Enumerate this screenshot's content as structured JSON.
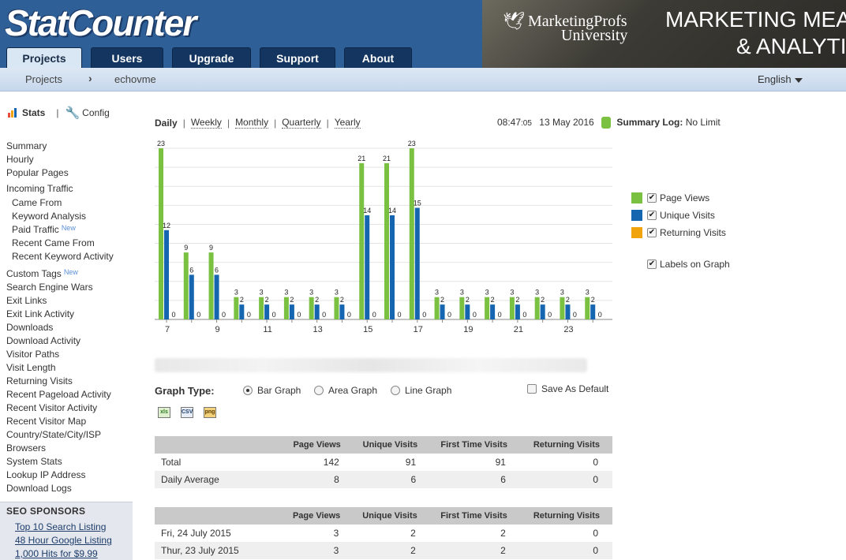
{
  "header": {
    "logo_text": "StatCounter",
    "banner_brand_line1": "MarketingProfs",
    "banner_brand_line2": "University",
    "banner_title_line1": "MARKETING MEASU",
    "banner_title_line2": "& ANALYTIC"
  },
  "tabs": [
    {
      "label": "Projects",
      "active": true
    },
    {
      "label": "Users",
      "active": false
    },
    {
      "label": "Upgrade",
      "active": false
    },
    {
      "label": "Support",
      "active": false
    },
    {
      "label": "About",
      "active": false
    }
  ],
  "breadcrumb": {
    "root": "Projects",
    "separator": "›",
    "project": "echovme"
  },
  "language": "English",
  "sidebar": {
    "stats_label": "Stats",
    "config_label": "Config",
    "pipe": "|",
    "items": [
      {
        "label": "Summary",
        "sub": false
      },
      {
        "label": "Hourly",
        "sub": false
      },
      {
        "label": "Popular Pages",
        "sub": false
      },
      {
        "label": "Incoming Traffic",
        "sub": false
      },
      {
        "label": "Came From",
        "sub": true
      },
      {
        "label": "Keyword Analysis",
        "sub": true
      },
      {
        "label": "Paid Traffic",
        "sub": true,
        "badge": "New"
      },
      {
        "label": "Recent Came From",
        "sub": true
      },
      {
        "label": "Recent Keyword Activity",
        "sub": true
      },
      {
        "label": "Custom Tags",
        "sub": false,
        "badge": "New"
      },
      {
        "label": "Search Engine Wars",
        "sub": false
      },
      {
        "label": "Exit Links",
        "sub": false
      },
      {
        "label": "Exit Link Activity",
        "sub": false
      },
      {
        "label": "Downloads",
        "sub": false
      },
      {
        "label": "Download Activity",
        "sub": false
      },
      {
        "label": "Visitor Paths",
        "sub": false
      },
      {
        "label": "Visit Length",
        "sub": false
      },
      {
        "label": "Returning Visits",
        "sub": false
      },
      {
        "label": "Recent Pageload Activity",
        "sub": false
      },
      {
        "label": "Recent Visitor Activity",
        "sub": false
      },
      {
        "label": "Recent Visitor Map",
        "sub": false
      },
      {
        "label": "Country/State/City/ISP",
        "sub": false
      },
      {
        "label": "Browsers",
        "sub": false
      },
      {
        "label": "System Stats",
        "sub": false
      },
      {
        "label": "Lookup IP Address",
        "sub": false
      },
      {
        "label": "Download Logs",
        "sub": false
      }
    ],
    "sponsors_title": "SEO SPONSORS",
    "sponsors": [
      "Top 10 Search Listing",
      "48 Hour Google Listing",
      "1,000 Hits for $9.99"
    ]
  },
  "periods": [
    {
      "label": "Daily",
      "current": true
    },
    {
      "label": "Weekly",
      "current": false
    },
    {
      "label": "Monthly",
      "current": false
    },
    {
      "label": "Quarterly",
      "current": false
    },
    {
      "label": "Yearly",
      "current": false
    }
  ],
  "period_separator": "|",
  "clock": {
    "time": "08:47",
    "seconds": ":05",
    "date": "13 May 2016",
    "log_label": "Summary Log:",
    "log_value": "No Limit"
  },
  "chart_data": {
    "type": "bar",
    "categories": [
      "7",
      "8",
      "9",
      "10",
      "11",
      "12",
      "13",
      "14",
      "15",
      "16",
      "17",
      "18",
      "19",
      "20",
      "21",
      "22",
      "23",
      "24"
    ],
    "x_tick_labels": [
      "7",
      "9",
      "11",
      "13",
      "15",
      "17",
      "19",
      "21",
      "23"
    ],
    "series": [
      {
        "name": "Page Views",
        "color": "#7ac142",
        "values": [
          23,
          9,
          9,
          3,
          3,
          3,
          3,
          3,
          21,
          21,
          23,
          3,
          3,
          3,
          3,
          3,
          3,
          3
        ]
      },
      {
        "name": "Unique Visits",
        "color": "#1565b0",
        "values": [
          12,
          6,
          6,
          2,
          2,
          2,
          2,
          2,
          14,
          14,
          15,
          2,
          2,
          2,
          2,
          2,
          2,
          2
        ]
      },
      {
        "name": "Returning Visits",
        "color": "#f0a30a",
        "values": [
          0,
          0,
          0,
          0,
          0,
          0,
          0,
          0,
          0,
          0,
          0,
          0,
          0,
          0,
          0,
          0,
          0,
          0
        ]
      }
    ],
    "ylim": [
      0,
      23
    ],
    "grid": true,
    "legend_position": "right",
    "data_labels": true
  },
  "legend_extra": "Labels on Graph",
  "graph_type": {
    "label": "Graph Type:",
    "options": [
      {
        "label": "Bar Graph",
        "selected": true
      },
      {
        "label": "Area Graph",
        "selected": false
      },
      {
        "label": "Line Graph",
        "selected": false
      }
    ],
    "save_default": "Save As Default"
  },
  "exports": [
    "xls",
    "CSV",
    "png"
  ],
  "summary_table": {
    "headers": [
      "",
      "Page Views",
      "Unique Visits",
      "First Time Visits",
      "Returning Visits"
    ],
    "rows": [
      [
        "Total",
        "142",
        "91",
        "91",
        "0"
      ],
      [
        "Daily Average",
        "8",
        "6",
        "6",
        "0"
      ]
    ]
  },
  "daily_table": {
    "headers": [
      "",
      "Page Views",
      "Unique Visits",
      "First Time Visits",
      "Returning Visits"
    ],
    "rows": [
      [
        "Fri, 24 July 2015",
        "3",
        "2",
        "2",
        "0"
      ],
      [
        "Thur, 23 July 2015",
        "3",
        "2",
        "2",
        "0"
      ]
    ]
  }
}
